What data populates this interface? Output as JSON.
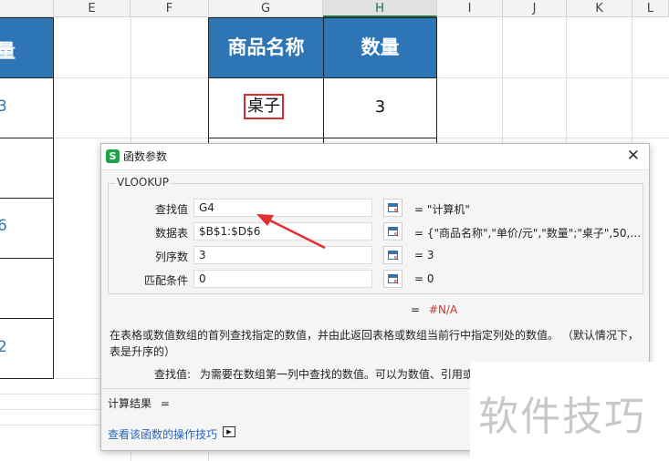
{
  "sheet": {
    "columns": [
      "E",
      "F",
      "G",
      "H",
      "I",
      "J",
      "K",
      "L"
    ],
    "header_partial": "量",
    "headers": {
      "product_name": "商品名称",
      "quantity": "数量"
    },
    "cell_g": "桌子",
    "cell_h": "3",
    "left_values": [
      "3",
      "",
      "6",
      "",
      "2"
    ]
  },
  "dialog": {
    "title": "函数参数",
    "close": "✕",
    "function_name": "VLOOKUP",
    "params": [
      {
        "label": "查找值",
        "value": "G4",
        "result": "= \"计算机\""
      },
      {
        "label": "数据表",
        "value": "$B$1:$D$6",
        "result": "= {\"商品名称\",\"单价/元\",\"数量\";\"桌子\",50,3..."
      },
      {
        "label": "列序数",
        "value": "3",
        "result": "= 3"
      },
      {
        "label": "匹配条件",
        "value": "0",
        "result": "= 0"
      }
    ],
    "overall_eq": "=",
    "overall_value": "#N/A",
    "description": "在表格或数值数组的首列查找指定的数值，并由此返回表格或数组当前行中指定列处的数值。 （默认情况下，表是升序的）",
    "arg_label": "查找值:",
    "arg_desc": "为需要在数组第一列中查找的数值。可以为数值、引用或",
    "calc_label": "计算结果",
    "calc_eq": "=",
    "help_link": "查看该函数的操作技巧"
  },
  "watermark": "软件技巧"
}
